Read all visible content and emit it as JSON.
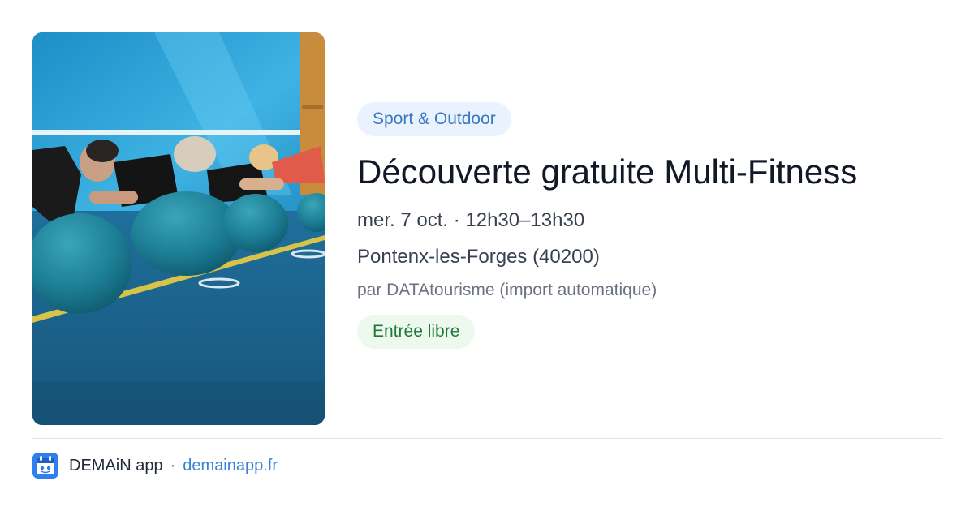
{
  "event": {
    "category": "Sport & Outdoor",
    "title": "Découverte gratuite Multi-Fitness",
    "date": "mer. 7 oct. · 12h30–13h30",
    "location": "Pontenx-les-Forges (40200)",
    "source": "par DATAtourisme (import automatique)",
    "price": "Entrée libre",
    "image": {
      "subject": "fitness-class-photo"
    }
  },
  "footer": {
    "app_name": "DEMAiN app",
    "separator": "·",
    "domain": "demainapp.fr",
    "logo_icon": "demain-app-logo-icon"
  },
  "colors": {
    "category_badge_bg": "#eaf2fd",
    "category_badge_text": "#3b78c4",
    "price_badge_bg": "#edf8ef",
    "price_badge_text": "#1f7a37",
    "link": "#3b82d6",
    "title": "#111827"
  }
}
